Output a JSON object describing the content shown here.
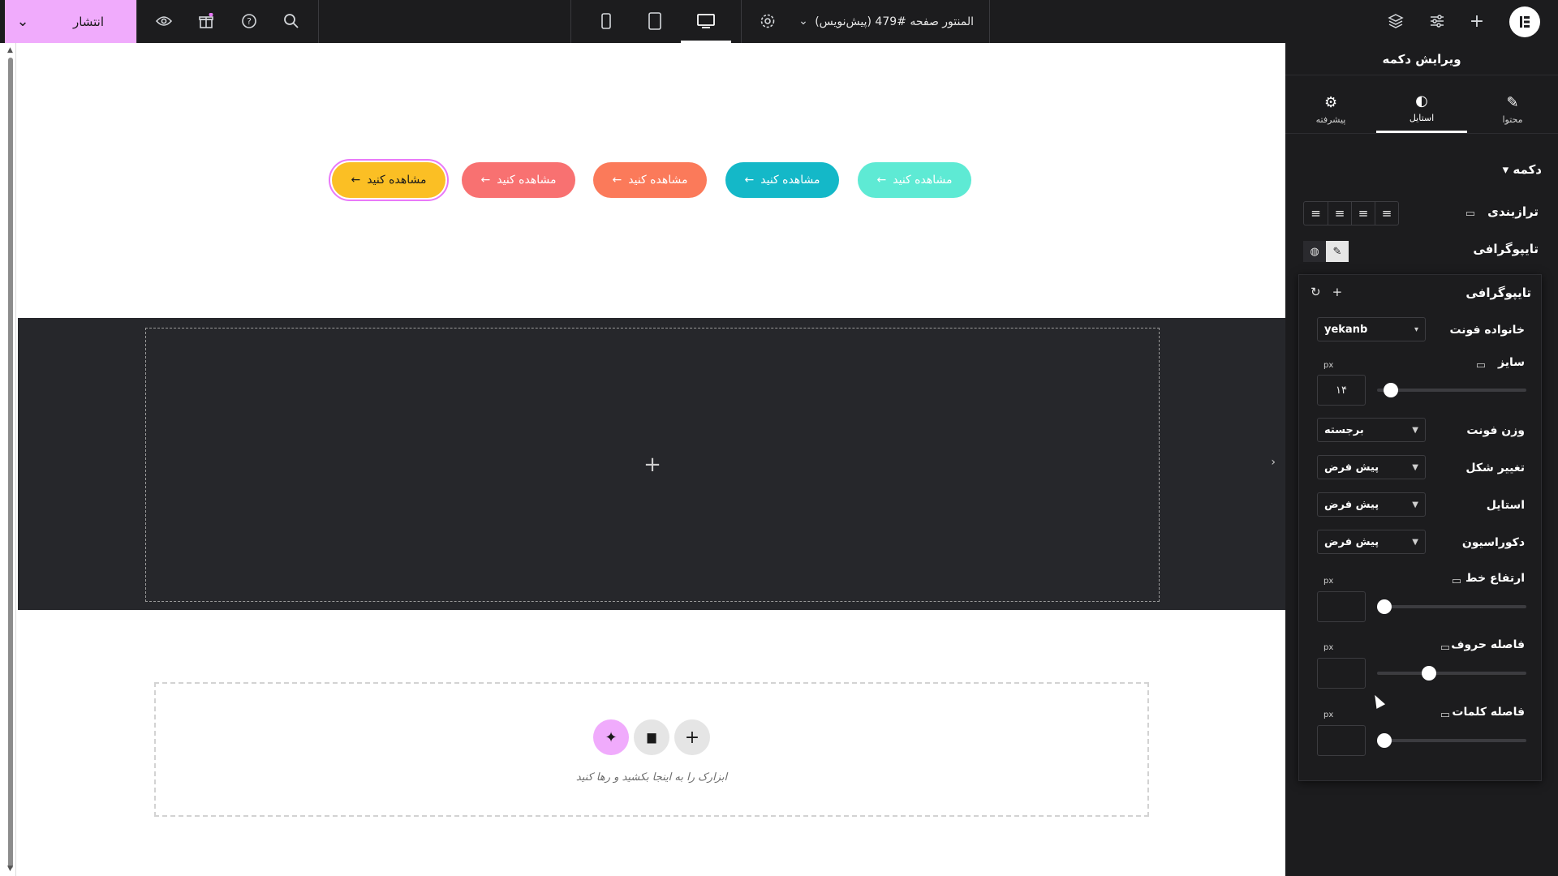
{
  "topbar": {
    "publish_label": "انتشار",
    "page_title": "المنتور صفحه #479 (پیش‌نویس)",
    "icons": [
      "chevron-down-icon",
      "eye-icon",
      "gift-icon",
      "help-icon",
      "search-icon",
      "mobile-icon",
      "tablet-icon",
      "desktop-icon",
      "settings-icon",
      "layers-icon",
      "sliders-icon",
      "plus-icon",
      "elementor-logo"
    ]
  },
  "canvas": {
    "buttons": [
      {
        "label": "مشاهده کنید",
        "arrow": "←",
        "color": "#fbbf24",
        "selected": true
      },
      {
        "label": "مشاهده کنید",
        "arrow": "←",
        "color": "#f87171",
        "selected": false
      },
      {
        "label": "مشاهده کنید",
        "arrow": "←",
        "color": "#fb7a5a",
        "selected": false
      },
      {
        "label": "مشاهده کنید",
        "arrow": "←",
        "color": "#14b8c8",
        "selected": false
      },
      {
        "label": "مشاهده کنید",
        "arrow": "←",
        "color": "#5eead4",
        "selected": false
      }
    ],
    "dark_drop_plus": "+",
    "side_chevron": "›",
    "drop_hint": "ابزارک را به اینجا بکشید و رها کنید",
    "drop_icons": {
      "ai": "✦",
      "folder": "▆",
      "plus": "+"
    }
  },
  "panel": {
    "title": "ویرایش دکمه",
    "tabs": [
      {
        "label": "محتوا",
        "icon": "✎"
      },
      {
        "label": "استایل",
        "icon": "◐"
      },
      {
        "label": "پیشرفته",
        "icon": "⚙"
      }
    ],
    "section_title": "دکمه",
    "section_caret": "▾",
    "alignment_label": "ترازبندی",
    "typography_label": "تایپوگرافی",
    "popup": {
      "title": "تایپوگرافی",
      "font_family_label": "خانواده فونت",
      "font_family_value": "yekanb",
      "size_label": "سایز",
      "size_value": "۱۴",
      "size_unit": "px",
      "size_slider": 0.05,
      "weight_label": "وزن فونت",
      "weight_value": "برجسته",
      "transform_label": "تغییر شکل",
      "transform_value": "پیش فرض",
      "style_label": "استایل",
      "style_value": "پیش فرض",
      "decoration_label": "دکوراسیون",
      "decoration_value": "پیش فرض",
      "line_height_label": "ارتفاع خط",
      "line_height_unit": "px",
      "line_height_slider": 0,
      "letter_spacing_label": "فاصله حروف",
      "letter_spacing_unit": "px",
      "letter_spacing_slider": 0.33,
      "word_spacing_label": "فاصله کلمات",
      "word_spacing_unit": "px",
      "word_spacing_slider": 0
    }
  }
}
